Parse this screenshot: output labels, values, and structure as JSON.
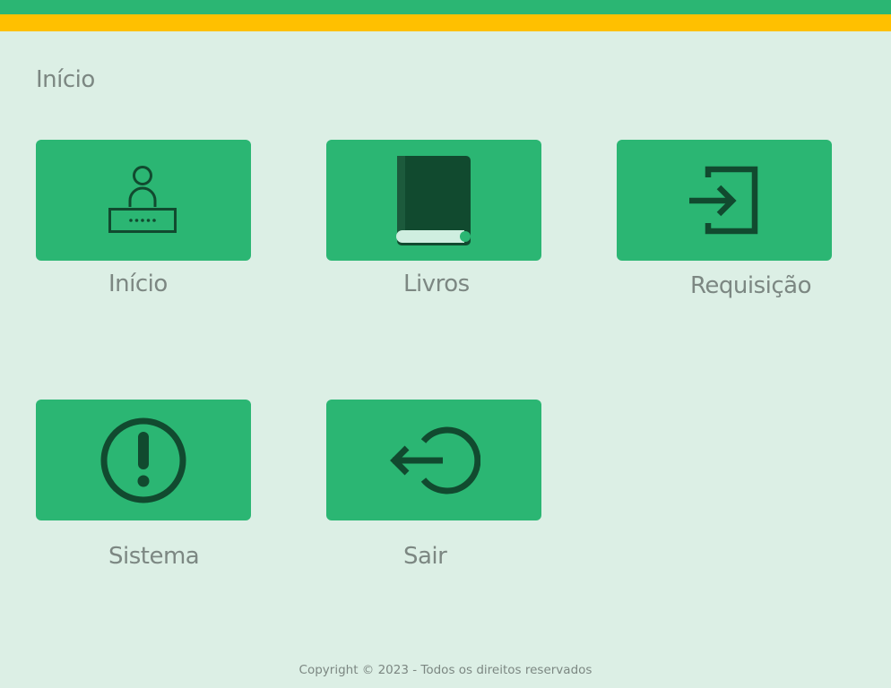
{
  "page": {
    "title": "Início"
  },
  "colors": {
    "header_green": "#2bb673",
    "header_yellow": "#ffc000",
    "background": "#dcefe5",
    "icon": "#114a2f",
    "text": "#7c8782"
  },
  "tiles": [
    {
      "label": "Início",
      "icon": "user-login-icon"
    },
    {
      "label": "Livros",
      "icon": "book-icon"
    },
    {
      "label": "Requisição",
      "icon": "sign-in-icon"
    },
    {
      "label": "Sistema",
      "icon": "exclamation-circle-icon"
    },
    {
      "label": "Sair",
      "icon": "logout-icon"
    }
  ],
  "footer": {
    "text": "Copyright © 2023 - Todos os direitos reservados"
  }
}
